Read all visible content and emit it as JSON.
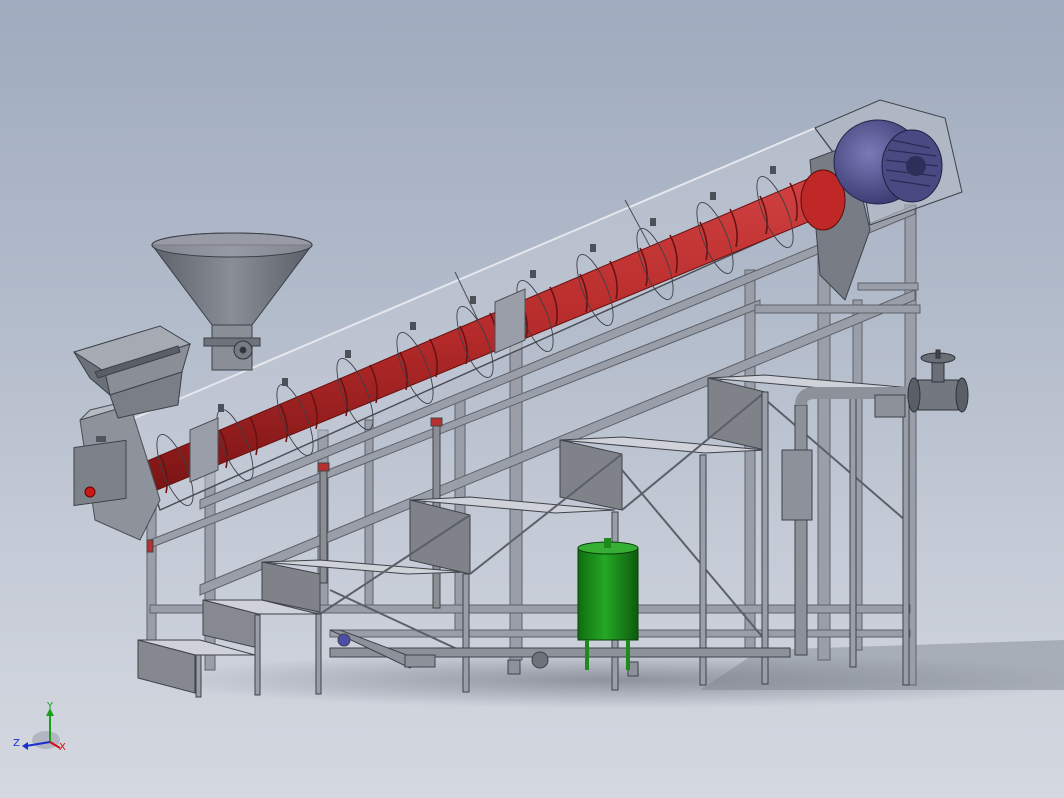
{
  "triad": {
    "x_label": "X",
    "y_label": "Y",
    "z_label": "Z",
    "x_color": "#d01010",
    "y_color": "#18a018",
    "z_color": "#1a2fd0"
  },
  "colors": {
    "screw": "#b52a2a",
    "motor": "#50508a",
    "tank": "#1a8a1a",
    "frame": "#8b8f99",
    "steel": "#7a7e88",
    "button": "#c81818"
  },
  "components": {
    "screw_conveyor": "screw-conveyor",
    "funnel_hopper": "funnel-hopper",
    "box_hopper": "box-hopper",
    "motor": "drive-motor",
    "stairs": "stair-platform",
    "tank": "green-tank",
    "valve": "gate-valve",
    "control_box": "control-box"
  }
}
